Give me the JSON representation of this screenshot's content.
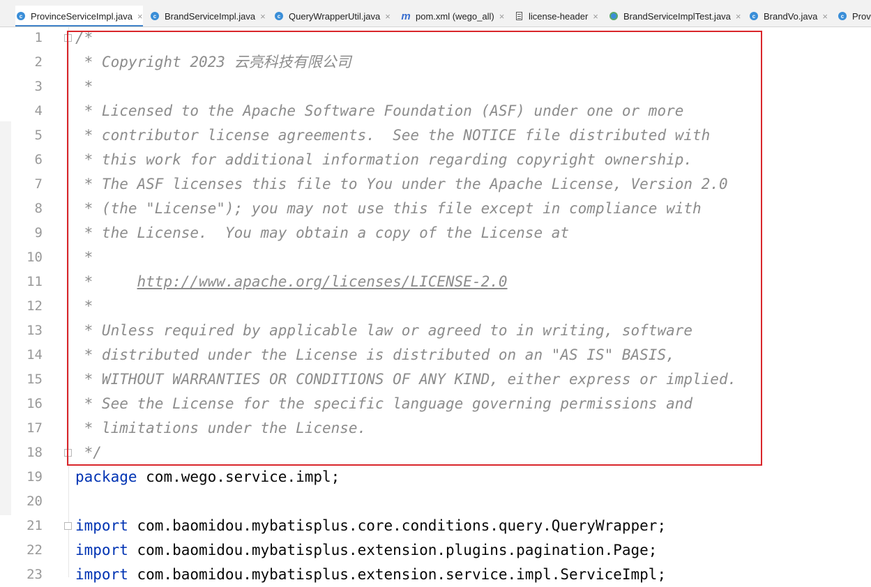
{
  "tabs": [
    {
      "label": "ProvinceServiceImpl.java",
      "icon": "class-icon",
      "active": true
    },
    {
      "label": "BrandServiceImpl.java",
      "icon": "class-icon",
      "active": false
    },
    {
      "label": "QueryWrapperUtil.java",
      "icon": "class-icon",
      "active": false
    },
    {
      "label": "pom.xml (wego_all)",
      "icon": "maven-icon",
      "active": false
    },
    {
      "label": "license-header",
      "icon": "text-file-icon",
      "active": false
    },
    {
      "label": "BrandServiceImplTest.java",
      "icon": "test-class-icon",
      "active": false
    },
    {
      "label": "BrandVo.java",
      "icon": "class-icon",
      "active": false
    },
    {
      "label": "Prov",
      "icon": "class-icon",
      "active": false
    }
  ],
  "tab_close_glyph": "×",
  "line_numbers": [
    "1",
    "2",
    "3",
    "4",
    "5",
    "6",
    "7",
    "8",
    "9",
    "10",
    "11",
    "12",
    "13",
    "14",
    "15",
    "16",
    "17",
    "18",
    "19",
    "20",
    "21",
    "22",
    "23"
  ],
  "code": {
    "l1": "/*",
    "l2": " * Copyright 2023 云亮科技有限公司",
    "l3": " *",
    "l4": " * Licensed to the Apache Software Foundation (ASF) under one or more",
    "l5": " * contributor license agreements.  See the NOTICE file distributed with",
    "l6": " * this work for additional information regarding copyright ownership.",
    "l7": " * The ASF licenses this file to You under the Apache License, Version 2.0",
    "l8": " * (the \"License\"); you may not use this file except in compliance with",
    "l9": " * the License.  You may obtain a copy of the License at",
    "l10": " *",
    "l11_prefix": " *     ",
    "l11_link": "http://www.apache.org/licenses/LICENSE-2.0",
    "l12": " *",
    "l13": " * Unless required by applicable law or agreed to in writing, software",
    "l14": " * distributed under the License is distributed on an \"AS IS\" BASIS,",
    "l15": " * WITHOUT WARRANTIES OR CONDITIONS OF ANY KIND, either express or implied.",
    "l16": " * See the License for the specific language governing permissions and",
    "l17": " * limitations under the License.",
    "l18": " */",
    "l19_kw": "package",
    "l19_rest": " com.wego.service.impl;",
    "l21_kw": "import",
    "l21_rest": " com.baomidou.mybatisplus.core.conditions.query.QueryWrapper;",
    "l22_kw": "import",
    "l22_rest": " com.baomidou.mybatisplus.extension.plugins.pagination.Page;",
    "l23_kw": "import",
    "l23_rest": " com.baomidou.mybatisplus.extension.service.impl.ServiceImpl;"
  },
  "colors": {
    "active_tab_underline": "#4083c9",
    "comment": "#8c8c8c",
    "keyword": "#0033b3",
    "highlight_box": "#d9262b"
  }
}
